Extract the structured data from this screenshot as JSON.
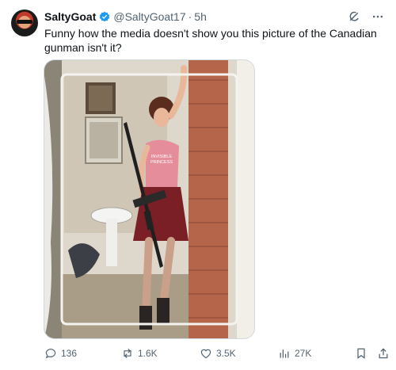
{
  "author": {
    "display_name": "SaltyGoat",
    "handle": "@SaltyGoat17",
    "separator": "·",
    "time": "5h",
    "verified_icon": "verified-badge-icon",
    "brand_color": "#1d9bf0"
  },
  "tweet": {
    "text": "Funny how the media doesn't show you this picture of the Canadian gunman isn't it?"
  },
  "media": {
    "shirt_text_line1": "INVISIBLE",
    "shirt_text_line2": "PRINCESS"
  },
  "top_actions": {
    "grok_icon": "grok-icon",
    "more_icon": "more-icon"
  },
  "actions": {
    "reply_count": "136",
    "retweet_count": "1.6K",
    "like_count": "3.5K",
    "views_count": "27K",
    "icons": [
      "reply-icon",
      "retweet-icon",
      "like-icon",
      "views-icon",
      "bookmark-icon",
      "share-icon"
    ]
  }
}
